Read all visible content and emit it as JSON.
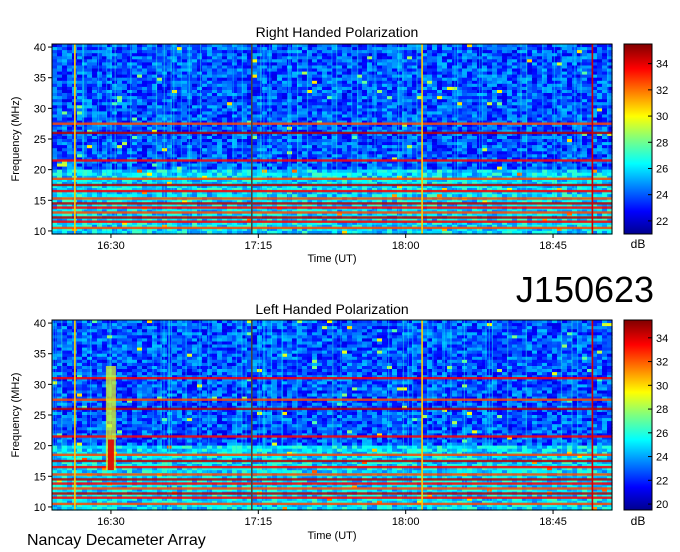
{
  "page_title": "J150623",
  "footer": "Nancay Decameter Array",
  "colors": {
    "spectrogram_scale": [
      "#00008f",
      "#0000ff",
      "#00bfff",
      "#40ffbf",
      "#ffff00",
      "#ff8000",
      "#ff0000",
      "#800000"
    ],
    "frame": "#000000",
    "background": "#ffffff"
  },
  "chart_data": [
    {
      "type": "heatmap",
      "title": "Right Handed Polarization",
      "xlabel": "Time (UT)",
      "ylabel": "Frequency (MHz)",
      "x_ticks": [
        "16:30",
        "17:15",
        "18:00",
        "18:45"
      ],
      "x_range": [
        "16:12",
        "19:03"
      ],
      "y_ticks": [
        10,
        15,
        20,
        25,
        30,
        35,
        40
      ],
      "ylim": [
        9.5,
        40.5
      ],
      "colorbar": {
        "label": "dB",
        "ticks": [
          22,
          24,
          26,
          28,
          30,
          32,
          34
        ],
        "range": [
          21,
          35.5
        ]
      },
      "features": {
        "strong_bands_mhz": [
          10.5,
          11.5,
          12.2,
          13.0,
          13.8,
          14.5,
          15.3,
          16.5,
          17.5,
          18.5,
          21.5,
          26.0,
          27.5
        ],
        "vertical_lines_ut": [
          "16:19",
          "17:13",
          "18:05",
          "18:57"
        ]
      }
    },
    {
      "type": "heatmap",
      "title": "Left Handed Polarization",
      "xlabel": "Time (UT)",
      "ylabel": "Frequency (MHz)",
      "x_ticks": [
        "16:30",
        "17:15",
        "18:00",
        "18:45"
      ],
      "x_range": [
        "16:12",
        "19:03"
      ],
      "y_ticks": [
        10,
        15,
        20,
        25,
        30,
        35,
        40
      ],
      "ylim": [
        9.5,
        40.5
      ],
      "colorbar": {
        "label": "dB",
        "ticks": [
          20,
          22,
          24,
          26,
          28,
          30,
          32,
          34
        ],
        "range": [
          19.5,
          35.5
        ]
      },
      "features": {
        "strong_bands_mhz": [
          10.5,
          11.5,
          12.2,
          13.0,
          13.8,
          14.5,
          15.3,
          16.5,
          17.5,
          18.5,
          21.5,
          26.0,
          27.5,
          31.0
        ],
        "vertical_lines_ut": [
          "16:19",
          "17:13",
          "18:05",
          "18:57"
        ],
        "burst_ut": "16:30"
      }
    }
  ]
}
